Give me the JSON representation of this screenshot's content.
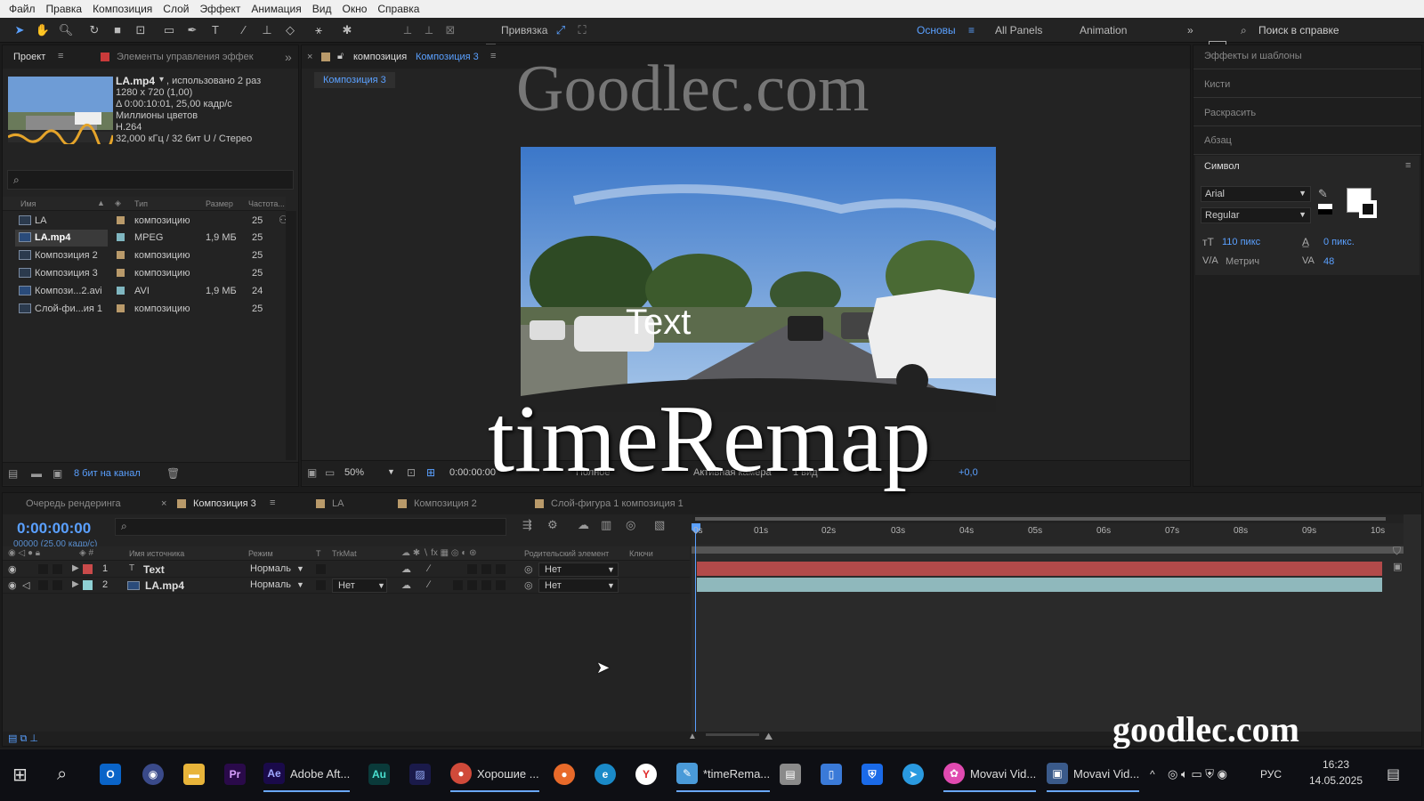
{
  "menubar": [
    "Файл",
    "Правка",
    "Композиция",
    "Слой",
    "Эффект",
    "Анимация",
    "Вид",
    "Окно",
    "Справка"
  ],
  "toolbar": {
    "snap_label": "Привязка",
    "workspaces": [
      "Основы",
      "All Panels",
      "Animation"
    ],
    "search_placeholder": "Поиск в справке"
  },
  "project": {
    "tab_project": "Проект",
    "tab_effects": "Элементы управления эффек",
    "file_name": "LA.mp4",
    "usage": ", использовано 2 раз",
    "meta": [
      "1280 x 720 (1,00)",
      "Δ 0:00:10:01, 25,00 кадр/с",
      "Миллионы цветов",
      "H.264",
      "32,000 кГц / 32 бит U / Стерео"
    ],
    "columns": [
      "Имя",
      "Тип",
      "Размер",
      "Частота..."
    ],
    "items": [
      {
        "name": "LA",
        "type": "композицию",
        "size": "",
        "rate": "25",
        "color": "#b99a6a"
      },
      {
        "name": "LA.mp4",
        "type": "MPEG",
        "size": "1,9 МБ",
        "rate": "25",
        "color": "#7fb6c0"
      },
      {
        "name": "Композиция 2",
        "type": "композицию",
        "size": "",
        "rate": "25",
        "color": "#b99a6a"
      },
      {
        "name": "Композиция 3",
        "type": "композицию",
        "size": "",
        "rate": "25",
        "color": "#b99a6a"
      },
      {
        "name": "Компози...2.avi",
        "type": "AVI",
        "size": "1,9 МБ",
        "rate": "24",
        "color": "#7fb6c0"
      },
      {
        "name": "Слой-фи...ия 1",
        "type": "композицию",
        "size": "",
        "rate": "25",
        "color": "#b99a6a"
      }
    ],
    "bit_depth": "8 бит на канал"
  },
  "comp": {
    "tab_label": "композиция",
    "comp_name": "Композиция 3",
    "breadcrumb": "Композиция 3",
    "video_text": "Text",
    "zoom": "50%",
    "timecode": "0:00:00:00",
    "quality": "Полное",
    "camera": "Активная камера",
    "views": "1 вид",
    "offset": "+0,0"
  },
  "right_panels": [
    "Эффекты и шаблоны",
    "Кисти",
    "Раскрасить",
    "Абзац"
  ],
  "character": {
    "title": "Символ",
    "font": "Arial",
    "style": "Regular",
    "size": "110 пикс",
    "leading": "0 пикс.",
    "kerning": "Метрич",
    "tracking": "48"
  },
  "timeline": {
    "tabs": [
      "Очередь рендеринга",
      "Композиция 3",
      "LA",
      "Композиция 2",
      "Слой-фигура 1 композиция 1"
    ],
    "timecode": "0:00:00:00",
    "frames": "00000 (25.00 кадр/с)",
    "columns": [
      "Имя источника",
      "Режим",
      "T",
      "TrkMat",
      "Родительский элемент",
      "Ключи"
    ],
    "layers": [
      {
        "num": "1",
        "name": "Text",
        "mode": "Нормаль",
        "trkmat": "",
        "parent": "Нет",
        "color": "#c94a4a"
      },
      {
        "num": "2",
        "name": "LA.mp4",
        "mode": "Нормаль",
        "trkmat": "Нет",
        "parent": "Нет",
        "color": "#8fd0d4"
      }
    ],
    "ruler": [
      "0s",
      "01s",
      "02s",
      "03s",
      "04s",
      "05s",
      "06s",
      "07s",
      "08s",
      "09s",
      "10s"
    ]
  },
  "watermarks": {
    "top": "Goodlec.com",
    "center": "timeRemap",
    "bottom": "goodlec.com"
  },
  "taskbar": {
    "apps": [
      "Adobe Aft...",
      "Хорошие ...",
      "*timeRema...",
      "Movavi Vid...",
      "Movavi Vid..."
    ],
    "lang": "РУС",
    "time": "16:23",
    "date": "14.05.2025"
  }
}
